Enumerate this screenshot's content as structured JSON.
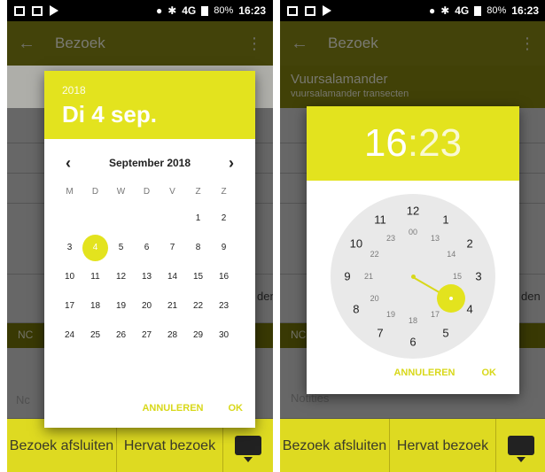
{
  "status": {
    "network": "4G",
    "battery": "80%",
    "time": "16:23"
  },
  "appbar": {
    "title": "Bezoek",
    "back": "←",
    "more": "⋮"
  },
  "subbar": {
    "title": "Vuursalamander",
    "subtitle": "vuursalamander transecten"
  },
  "background": {
    "header": "NC",
    "partial_right": "den",
    "partial_notities": "Nc",
    "notities": "Notities"
  },
  "bottom": {
    "end_visit": "Bezoek afsluiten",
    "resume_visit": "Hervat bezoek"
  },
  "date_dialog": {
    "year": "2018",
    "date": "Di 4 sep.",
    "month": "September 2018",
    "prev": "‹",
    "next": "›",
    "weekdays": [
      "M",
      "D",
      "W",
      "D",
      "V",
      "Z",
      "Z"
    ],
    "leading_blanks": 5,
    "days": [
      "1",
      "2",
      "3",
      "4",
      "5",
      "6",
      "7",
      "8",
      "9",
      "10",
      "11",
      "12",
      "13",
      "14",
      "15",
      "16",
      "17",
      "18",
      "19",
      "20",
      "21",
      "22",
      "23",
      "24",
      "25",
      "26",
      "27",
      "28",
      "29",
      "30"
    ],
    "selected_day": "4",
    "cancel": "ANNULEREN",
    "ok": "OK"
  },
  "time_dialog": {
    "hour": "16",
    "colon": ":",
    "minute": "23",
    "outer": [
      "12",
      "1",
      "2",
      "3",
      "4",
      "5",
      "6",
      "7",
      "8",
      "9",
      "10",
      "11"
    ],
    "inner": [
      "00",
      "13",
      "14",
      "15",
      "16",
      "17",
      "18",
      "19",
      "20",
      "21",
      "22",
      "23"
    ],
    "selected_inner_index": 4,
    "cancel": "ANNULEREN",
    "ok": "OK"
  },
  "colors": {
    "accent": "#e3e31e",
    "appbar": "#5e5e0e",
    "bottom": "#e0d71c"
  }
}
